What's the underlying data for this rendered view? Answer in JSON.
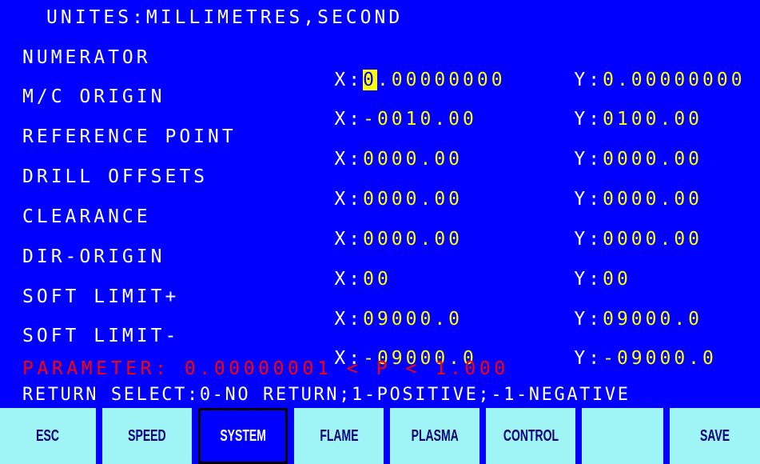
{
  "header": "UNITES:MILLIMETRES,SECOND",
  "rows": [
    {
      "label": "NUMERATOR",
      "x_prefix": "X:",
      "x_cursor": "0",
      "x_value": ".00000000",
      "y_prefix": "Y:",
      "y_value": "0.00000000"
    },
    {
      "label": "M/C ORIGIN",
      "x_prefix": "X:",
      "x_value": "-0010.00",
      "y_prefix": "Y:",
      "y_value": "0100.00"
    },
    {
      "label": "REFERENCE POINT",
      "x_prefix": "X:",
      "x_value": "0000.00",
      "y_prefix": "Y:",
      "y_value": "0000.00"
    },
    {
      "label": "DRILL OFFSETS",
      "x_prefix": "X:",
      "x_value": "0000.00",
      "y_prefix": "Y:",
      "y_value": "0000.00"
    },
    {
      "label": "CLEARANCE",
      "x_prefix": "X:",
      "x_value": "0000.00",
      "y_prefix": "Y:",
      "y_value": "0000.00"
    },
    {
      "label": "DIR-ORIGIN",
      "x_prefix": "X:",
      "x_value": "00",
      "y_prefix": "Y:",
      "y_value": "00"
    },
    {
      "label": "SOFT LIMIT+",
      "x_prefix": "X:",
      "x_value": "09000.0",
      "y_prefix": "Y:",
      "y_value": "09000.0"
    },
    {
      "label": "SOFT LIMIT-",
      "x_prefix": "X:",
      "x_value": "-09000.0",
      "y_prefix": "Y:",
      "y_value": "-09000.0"
    }
  ],
  "parameter_hint": "PARAMETER: 0.00000001 < P < 1.000",
  "return_hint": "RETURN SELECT:0-NO RETURN;1-POSITIVE;-1-NEGATIVE",
  "softkeys": [
    "ESC",
    "SPEED",
    "SYSTEM",
    "FLAME",
    "PLASMA",
    "CONTROL",
    "",
    "SAVE"
  ],
  "active_softkey": "SYSTEM",
  "colors": {
    "background": "#0000ff",
    "label": "#ffffff",
    "value": "#ffff00",
    "hint": "#ff0000",
    "softkey": "#9ff5f5"
  }
}
